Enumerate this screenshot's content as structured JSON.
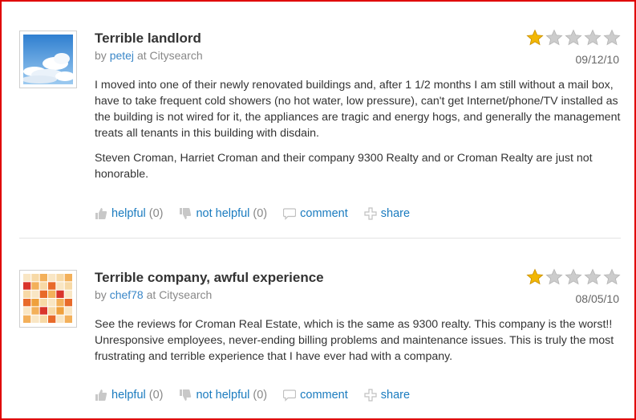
{
  "reviews": [
    {
      "title": "Terrible landlord",
      "by": "by",
      "user": "petej",
      "source": "at Citysearch",
      "date": "09/12/10",
      "rating": 1,
      "max_rating": 5,
      "paragraphs": [
        "I moved into one of their newly renovated buildings and, after 1 1/2 months I am still without a mail box, have to take frequent cold showers (no hot water, low pressure), can't get Internet/phone/TV installed as the building is not wired for it, the appliances are tragic and energy hogs, and generally the management treats all tenants in this building with disdain.",
        "Steven Croman, Harriet Croman and their company 9300 Realty and or Croman Realty are just not honorable."
      ],
      "actions": {
        "helpful": "helpful",
        "helpful_count": "(0)",
        "not_helpful": "not helpful",
        "not_helpful_count": "(0)",
        "comment": "comment",
        "share": "share"
      },
      "avatar_icon": "cloudy-sky-avatar"
    },
    {
      "title": "Terrible company, awful experience",
      "by": "by",
      "user": "chef78",
      "source": "at Citysearch",
      "date": "08/05/10",
      "rating": 1,
      "max_rating": 5,
      "paragraphs": [
        "See the reviews for Croman Real Estate, which is the same as 9300 realty. This company is the worst!! Unresponsive employees, never-ending billing problems and maintenance issues. This is truly the most frustrating and terrible experience that I have ever had with a company."
      ],
      "actions": {
        "helpful": "helpful",
        "helpful_count": "(0)",
        "not_helpful": "not helpful",
        "not_helpful_count": "(0)",
        "comment": "comment",
        "share": "share"
      },
      "avatar_icon": "orange-mosaic-avatar"
    }
  ],
  "colors": {
    "frame_border": "#e00000",
    "link": "#1a7bbf",
    "user_link": "#3a87c8",
    "star_on": "#f2b705",
    "star_off": "#cccccc"
  }
}
